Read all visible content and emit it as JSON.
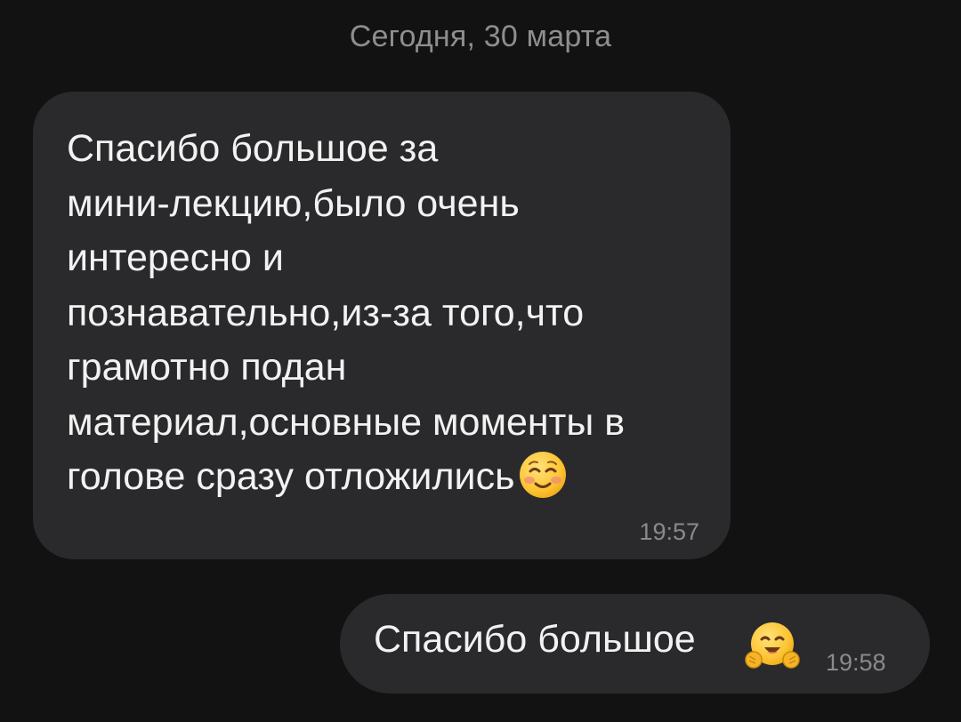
{
  "date_header": "Сегодня, 30 марта",
  "messages": [
    {
      "direction": "incoming",
      "text": "Спасибо большое за\nмини-лекцию,было очень\nинтересно и\nпознавательно,из-за того,что\nграмотно подан\nматериал,основные моменты в\nголове сразу отложились",
      "emoji": "smiling-face-emoji",
      "time": "19:57"
    },
    {
      "direction": "outgoing",
      "text": "Спасибо большое",
      "emoji": "hugging-face-emoji",
      "time": "19:58"
    }
  ],
  "colors": {
    "background": "#121212",
    "bubble": "#2a2a2c",
    "text": "#f2f2f2",
    "muted": "#8e8e8e",
    "emoji_yellow": "#fbc02d"
  }
}
